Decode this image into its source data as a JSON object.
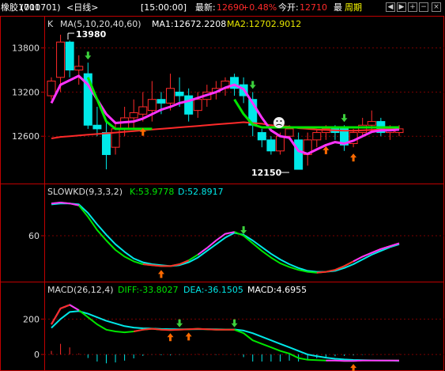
{
  "header": {
    "name": "橡胶1701",
    "code": "(010701)",
    "period": "<日线>",
    "date": "[15:00:00]",
    "latest_label": "最新:",
    "latest_value": "12690",
    "change": "+0.48%",
    "open_label": "今开:",
    "open_value": "12710",
    "period_tab_1": "最",
    "period_tab_2": "周期"
  },
  "colors": {
    "red": "#ff2a2a",
    "green": "#00e600",
    "cyan": "#00e8e8",
    "magenta": "#ff33ff",
    "yellow": "#e8e800",
    "grid": "#7a0000",
    "axis": "#c00000"
  },
  "panels": {
    "price": {
      "indicator": "K",
      "ma_label": "MA(5,10,20,40,60)",
      "ma1": "MA1:12672.2208",
      "ma2": "MA2:12702.9012",
      "high_marker": "13980",
      "low_marker": "12150"
    },
    "kd": {
      "label": "SLOWKD(9,3,3,2)",
      "k": "K:53.9778",
      "d": "D:52.8917"
    },
    "macd": {
      "label": "MACD(26,12,4)",
      "diff": "DIFF:-33.8027",
      "dea": "DEA:-36.1505",
      "macd": "MACD:4.6955"
    }
  },
  "chart_data": [
    {
      "type": "candlestick",
      "panel": "price",
      "yticks": [
        13800,
        13200,
        12600
      ],
      "ylim": [
        12000,
        14000
      ],
      "candles": [
        {
          "o": 13150,
          "c": 13350,
          "h": 13400,
          "l": 13100
        },
        {
          "o": 13400,
          "c": 13880,
          "h": 13980,
          "l": 13200
        },
        {
          "o": 13880,
          "c": 13500,
          "h": 13900,
          "l": 13400
        },
        {
          "o": 13500,
          "c": 13550,
          "h": 13700,
          "l": 13300
        },
        {
          "o": 13450,
          "c": 12750,
          "h": 13600,
          "l": 12700
        },
        {
          "o": 12750,
          "c": 12700,
          "h": 13000,
          "l": 12600
        },
        {
          "o": 12650,
          "c": 12350,
          "h": 12800,
          "l": 12150
        },
        {
          "o": 12450,
          "c": 12700,
          "h": 12800,
          "l": 12350
        },
        {
          "o": 12700,
          "c": 12850,
          "h": 13000,
          "l": 12600
        },
        {
          "o": 12850,
          "c": 12920,
          "h": 13100,
          "l": 12700
        },
        {
          "o": 12900,
          "c": 13000,
          "h": 13200,
          "l": 12800
        },
        {
          "o": 12950,
          "c": 13100,
          "h": 13350,
          "l": 12800
        },
        {
          "o": 13100,
          "c": 13050,
          "h": 13200,
          "l": 12900
        },
        {
          "o": 13050,
          "c": 13250,
          "h": 13450,
          "l": 12950
        },
        {
          "o": 13200,
          "c": 13150,
          "h": 13400,
          "l": 13000
        },
        {
          "o": 13150,
          "c": 12900,
          "h": 13250,
          "l": 12800
        },
        {
          "o": 12950,
          "c": 13100,
          "h": 13200,
          "l": 12850
        },
        {
          "o": 13100,
          "c": 13200,
          "h": 13300,
          "l": 13000
        },
        {
          "o": 13200,
          "c": 13250,
          "h": 13350,
          "l": 13100
        },
        {
          "o": 13250,
          "c": 13350,
          "h": 13400,
          "l": 13150
        },
        {
          "o": 13400,
          "c": 13250,
          "h": 13450,
          "l": 13150
        },
        {
          "o": 13300,
          "c": 13150,
          "h": 13400,
          "l": 13050
        },
        {
          "o": 13100,
          "c": 12750,
          "h": 13200,
          "l": 12600
        },
        {
          "o": 12650,
          "c": 12550,
          "h": 12700,
          "l": 12450
        },
        {
          "o": 12550,
          "c": 12400,
          "h": 12600,
          "l": 12350
        },
        {
          "o": 12400,
          "c": 12600,
          "h": 12650,
          "l": 12350
        },
        {
          "o": 12600,
          "c": 12700,
          "h": 12750,
          "l": 12550
        },
        {
          "o": 12550,
          "c": 12150,
          "h": 12650,
          "l": 12150
        },
        {
          "o": 12350,
          "c": 12550,
          "h": 12650,
          "l": 12200
        },
        {
          "o": 12550,
          "c": 12650,
          "h": 12700,
          "l": 12450
        },
        {
          "o": 12650,
          "c": 12700,
          "h": 12750,
          "l": 12550
        },
        {
          "o": 12700,
          "c": 12650,
          "h": 12750,
          "l": 12550
        },
        {
          "o": 12700,
          "c": 12480,
          "h": 12750,
          "l": 12400
        },
        {
          "o": 12500,
          "c": 12650,
          "h": 12700,
          "l": 12450
        },
        {
          "o": 12650,
          "c": 12750,
          "h": 12850,
          "l": 12600
        },
        {
          "o": 12750,
          "c": 12800,
          "h": 12950,
          "l": 12650
        },
        {
          "o": 12800,
          "c": 12650,
          "h": 12850,
          "l": 12600
        },
        {
          "o": 12650,
          "c": 12700,
          "h": 12750,
          "l": 12550
        },
        {
          "o": 12650,
          "c": 12700,
          "h": 12750,
          "l": 12600
        }
      ],
      "ma_fast": [
        13050,
        13300,
        13360,
        13420,
        13300,
        13100,
        12900,
        12780,
        12790,
        12800,
        12840,
        12900,
        12960,
        13000,
        13050,
        13080,
        13120,
        13160,
        13200,
        13260,
        13300,
        13240,
        13050,
        12850,
        12680,
        12600,
        12580,
        12400,
        12360,
        12420,
        12480,
        12520,
        12500,
        12540,
        12600,
        12660,
        12680,
        12680,
        12690
      ],
      "ma_slow": [
        12570,
        12590,
        12600,
        12610,
        12620,
        12630,
        12640,
        12650,
        12660,
        12670,
        12680,
        12690,
        12700,
        12710,
        12720,
        12730,
        12740,
        12750,
        12760,
        12770,
        12780,
        12790,
        12780,
        12770,
        12750,
        12740,
        12730,
        12710,
        12700,
        12690,
        12685,
        12680,
        12675,
        12675,
        12680,
        12685,
        12690,
        12695,
        12700
      ],
      "ma_thick": [
        null,
        null,
        null,
        null,
        13400,
        13100,
        12800,
        12700,
        12700,
        12700,
        12700,
        12700,
        null,
        null,
        null,
        null,
        null,
        null,
        null,
        null,
        13100,
        12900,
        12760,
        12720,
        12720,
        12720,
        12720,
        12720,
        12720,
        12720,
        12720,
        12720,
        12720,
        12720,
        12720,
        12720,
        12720,
        12720,
        12720
      ],
      "arrows_up": [
        10,
        30,
        33
      ],
      "arrows_down": [
        4,
        22,
        32
      ]
    },
    {
      "type": "line",
      "panel": "kd",
      "yticks": [
        60
      ],
      "ylim": [
        15,
        100
      ],
      "series": [
        {
          "name": "K",
          "color": "green",
          "values": [
            94,
            95,
            94,
            92,
            80,
            66,
            55,
            45,
            38,
            33,
            30,
            29,
            28,
            28,
            30,
            34,
            40,
            47,
            55,
            62,
            64,
            60,
            52,
            44,
            37,
            31,
            27,
            24,
            22,
            21,
            22,
            24,
            28,
            33,
            38,
            42,
            46,
            49,
            52
          ]
        },
        {
          "name": "D",
          "color": "cyan",
          "values": [
            93,
            94,
            94,
            93,
            84,
            72,
            61,
            51,
            43,
            36,
            32,
            30,
            29,
            28,
            29,
            32,
            37,
            44,
            51,
            58,
            63,
            61,
            55,
            48,
            41,
            35,
            30,
            26,
            23,
            22,
            22,
            23,
            26,
            30,
            35,
            40,
            44,
            48,
            51
          ]
        }
      ],
      "arrows_up": [
        12
      ],
      "arrows_down": [
        21
      ]
    },
    {
      "type": "macd",
      "panel": "macd",
      "yticks": [
        200,
        0
      ],
      "ylim": [
        -80,
        340
      ],
      "diff": [
        170,
        260,
        280,
        250,
        210,
        170,
        140,
        130,
        125,
        130,
        140,
        145,
        140,
        138,
        140,
        142,
        145,
        142,
        140,
        140,
        140,
        120,
        80,
        60,
        40,
        20,
        5,
        -20,
        -30,
        -32,
        -34,
        -34,
        -36,
        -36,
        -34,
        -34,
        -34,
        -34,
        -34
      ],
      "dea": [
        150,
        200,
        240,
        245,
        230,
        210,
        190,
        175,
        160,
        152,
        148,
        146,
        144,
        143,
        142,
        142,
        143,
        143,
        142,
        141,
        141,
        135,
        120,
        100,
        80,
        60,
        40,
        20,
        0,
        -10,
        -18,
        -24,
        -28,
        -31,
        -32,
        -33,
        -34,
        -35,
        -36
      ],
      "macd": [
        20,
        60,
        40,
        5,
        -20,
        -40,
        -50,
        -45,
        -35,
        -22,
        -8,
        -1,
        -4,
        -5,
        -2,
        0,
        2,
        -1,
        -2,
        -1,
        -1,
        -15,
        -40,
        -40,
        -40,
        -40,
        -35,
        -40,
        -30,
        -22,
        -16,
        -10,
        -8,
        -5,
        -2,
        -1,
        0,
        1,
        2
      ],
      "arrows_up": [
        13,
        15,
        33
      ],
      "arrows_down": [
        14,
        20
      ]
    }
  ]
}
